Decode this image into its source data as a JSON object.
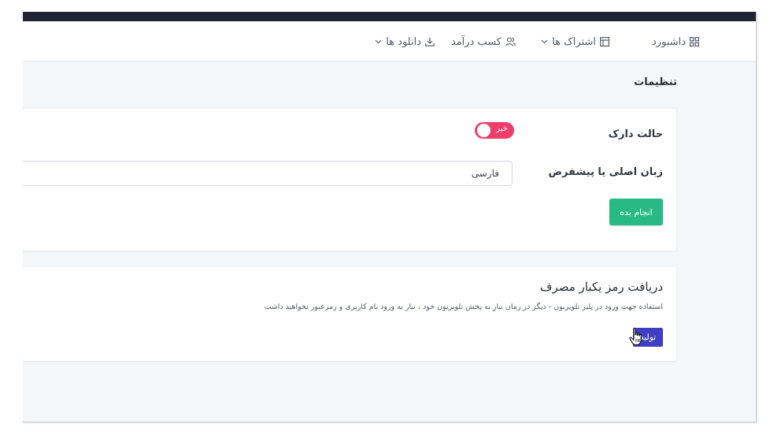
{
  "nav": {
    "dashboard": "داشبورد",
    "subscriptions": "اشتراک ها",
    "earnings": "کسب درآمد",
    "downloads": "دانلود ها"
  },
  "page": {
    "title": "تنظیمات"
  },
  "settings": {
    "dark_mode_label": "حالت دارک",
    "dark_mode_state": "خیر",
    "language_label": "زبان اصلی یا پیشفرض",
    "language_value": "فارسی",
    "submit_label": "انجام بده"
  },
  "otp": {
    "title": "دریافت رمز یکبار مصرف",
    "description": "استفاده جهت ورود در پلیر تلویزیون - دیگر در زمان نیاز به پخش تلویزیون خود ، نیاز به ورود نام کاربری و رمزعبور نخواهید داشت",
    "generate_label": "تولید"
  },
  "colors": {
    "topbar": "#1e2433",
    "toggle_off": "#ef3e6a",
    "submit_button": "#27b986",
    "generate_button": "#3f3fc4",
    "background": "#f5f6f8"
  },
  "icons": [
    "grid-icon",
    "table-icon",
    "users-icon",
    "download-icon",
    "chevron-down-icon",
    "hand-cursor-icon"
  ]
}
